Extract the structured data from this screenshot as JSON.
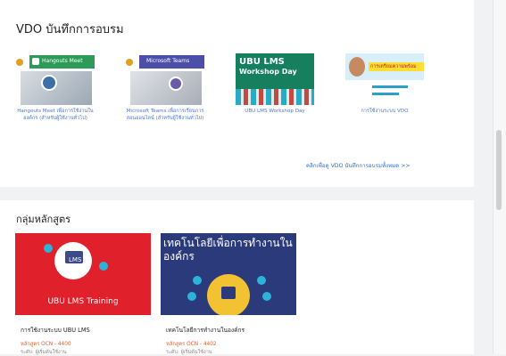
{
  "vdo_section": {
    "title": "VDO บันทึกการอบรม",
    "items": [
      {
        "thumb_text": "Hangouts Meet",
        "label": "Hangouts Meet เพื่อการใช้งานในองค์กร (สำหรับผู้ใช้งานทั่วไป)"
      },
      {
        "thumb_text": "Microsoft Teams",
        "label": "Microsoft Teams เพื่อการเรียนการสอนออนไลน์ (สำหรับผู้ใช้งานทั่วไป)"
      },
      {
        "thumb_text": "UBU LMS",
        "thumb_sub": "Workshop Day",
        "label": "UBU LMS Workshop Day"
      },
      {
        "thumb_text": "การเตรียมความพร้อม",
        "label": "การใช้งานระบบ VDO"
      }
    ],
    "more_link": "คลิกเพื่อดู VDO บันทึกการอบรมทั้งหมด >>"
  },
  "course_section": {
    "title": "กลุ่มหลักสูตร",
    "courses": [
      {
        "image_caption": "UBU LMS Training",
        "title": "การใช้งานระบบ UBU LMS",
        "code": "หลักสูตร OCN - 4400",
        "meta": "ระดับ: ผู้เริ่มต้นใช้งาน"
      },
      {
        "image_caption": "เทคโนโลยีเพื่อการทำงานในองค์กร",
        "title": "เทคโนโลยีการทำงานในองค์กร",
        "code": "หลักสูตร OCN - 4402",
        "meta": "ระดับ: ผู้เริ่มต้นใช้งาน"
      }
    ]
  },
  "colors": {
    "accent": "#2f6fd1",
    "red": "#e0202a",
    "navy": "#2b3a7a"
  }
}
